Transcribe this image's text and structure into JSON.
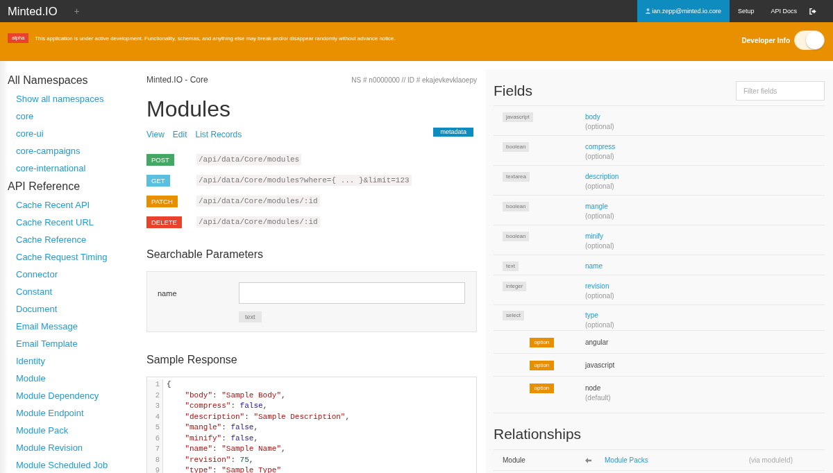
{
  "app_bar": {
    "brand": "Minted.IO",
    "add_button": "+",
    "nav": [
      {
        "kind": "user",
        "label": "ian.zepp@minted.io.core",
        "selected": true
      },
      {
        "kind": "link",
        "label": "Setup",
        "selected": false
      },
      {
        "kind": "link",
        "label": "API Docs",
        "selected": false
      },
      {
        "kind": "logout",
        "selected": false
      }
    ]
  },
  "banner": {
    "badge": "alpha",
    "message": "This application is under active development. Functionality, schemas, and anything else may break and/or disappear randomly without advance notice.",
    "toggle": {
      "label": "Developer Info",
      "on": true
    }
  },
  "sidebar": {
    "sections": [
      {
        "title": "All Namespaces",
        "items": [
          "Show all namespaces",
          "core",
          "core-ui",
          "core-campaigns",
          "core-international"
        ]
      },
      {
        "title": "API Reference",
        "items": [
          "Cache Recent API",
          "Cache Recent URL",
          "Cache Reference",
          "Cache Request Timing",
          "Connector",
          "Constant",
          "Document",
          "Email Message",
          "Email Template",
          "Identity",
          "Module",
          "Module Dependency",
          "Module Endpoint",
          "Module Pack",
          "Module Revision",
          "Module Scheduled Job"
        ]
      }
    ]
  },
  "main": {
    "breadcrumb": "Minted.IO - Core",
    "meta": "NS # n0000000 // ID # ekajevkevklaoepy",
    "title": "Modules",
    "links": [
      "View",
      "Edit",
      "List Records"
    ],
    "badge": "metadata",
    "endpoints": [
      {
        "method": "POST",
        "color": "#43a863",
        "path": "/api/data/Core/modules"
      },
      {
        "method": "GET",
        "color": "#5bc0de",
        "path": "/api/data/Core/modules?where={ ... }&limit=123"
      },
      {
        "method": "PATCH",
        "color": "#e88f00",
        "path": "/api/data/Core/modules/:id"
      },
      {
        "method": "DELETE",
        "color": "#e8412c",
        "path": "/api/data/Core/modules/:id"
      }
    ],
    "search": {
      "title": "Searchable Parameters",
      "params": [
        {
          "label": "name",
          "type": "text"
        }
      ]
    },
    "sample": {
      "title": "Sample Response",
      "lines": [
        {
          "number": "1",
          "tokens": [
            {
              "kind": "punct",
              "text": "{"
            }
          ],
          "children": [
            {
              "number": "2",
              "tokens": [
                {
                  "kind": "key",
                  "text": "\"body\""
                },
                {
                  "kind": "punct",
                  "text": ": "
                },
                {
                  "kind": "string",
                  "text": "\"Sample Body\""
                },
                {
                  "kind": "punct",
                  "text": ","
                }
              ]
            },
            {
              "number": "3",
              "tokens": [
                {
                  "kind": "key",
                  "text": "\"compress\""
                },
                {
                  "kind": "punct",
                  "text": ": "
                },
                {
                  "kind": "atom",
                  "text": "false"
                },
                {
                  "kind": "punct",
                  "text": ","
                }
              ]
            },
            {
              "number": "4",
              "tokens": [
                {
                  "kind": "key",
                  "text": "\"description\""
                },
                {
                  "kind": "punct",
                  "text": ": "
                },
                {
                  "kind": "string",
                  "text": "\"Sample Description\""
                },
                {
                  "kind": "punct",
                  "text": ","
                }
              ]
            },
            {
              "number": "5",
              "tokens": [
                {
                  "kind": "key",
                  "text": "\"mangle\""
                },
                {
                  "kind": "punct",
                  "text": ": "
                },
                {
                  "kind": "atom",
                  "text": "false"
                },
                {
                  "kind": "punct",
                  "text": ","
                }
              ]
            },
            {
              "number": "6",
              "tokens": [
                {
                  "kind": "key",
                  "text": "\"minify\""
                },
                {
                  "kind": "punct",
                  "text": ": "
                },
                {
                  "kind": "atom",
                  "text": "false"
                },
                {
                  "kind": "punct",
                  "text": ","
                }
              ]
            },
            {
              "number": "7",
              "tokens": [
                {
                  "kind": "key",
                  "text": "\"name\""
                },
                {
                  "kind": "punct",
                  "text": ": "
                },
                {
                  "kind": "string",
                  "text": "\"Sample Name\""
                },
                {
                  "kind": "punct",
                  "text": ","
                }
              ]
            },
            {
              "number": "8",
              "tokens": [
                {
                  "kind": "key",
                  "text": "\"revision\""
                },
                {
                  "kind": "punct",
                  "text": ": "
                },
                {
                  "kind": "number",
                  "text": "75"
                },
                {
                  "kind": "punct",
                  "text": ","
                }
              ]
            },
            {
              "number": "9",
              "tokens": [
                {
                  "kind": "key",
                  "text": "\"type\""
                },
                {
                  "kind": "punct",
                  "text": ": "
                },
                {
                  "kind": "string",
                  "text": "\"Sample Type\""
                }
              ]
            }
          ]
        }
      ]
    }
  },
  "fields_panel": {
    "title": "Fields",
    "filter": {
      "placeholder": "Filter fields"
    },
    "fields": [
      {
        "type": "javascript",
        "name": "body",
        "note": "(optional)"
      },
      {
        "type": "boolean",
        "name": "compress",
        "note": "(optional)"
      },
      {
        "type": "textarea",
        "name": "description",
        "note": "(optional)"
      },
      {
        "type": "boolean",
        "name": "mangle",
        "note": "(optional)"
      },
      {
        "type": "boolean",
        "name": "minify",
        "note": "(optional)"
      },
      {
        "type": "text",
        "name": "name"
      },
      {
        "type": "integer",
        "name": "revision",
        "note": "(optional)"
      },
      {
        "type": "select",
        "name": "type",
        "note": "(optional)",
        "options": [
          {
            "badge": "option",
            "value": "angular"
          },
          {
            "badge": "option",
            "value": "javascript"
          },
          {
            "badge": "option",
            "value": "node",
            "note": "(default)"
          }
        ]
      }
    ]
  },
  "relationships": {
    "title": "Relationships",
    "rows": [
      {
        "source": "Module",
        "target": "Module Packs",
        "via": "(via moduleId)"
      }
    ]
  }
}
